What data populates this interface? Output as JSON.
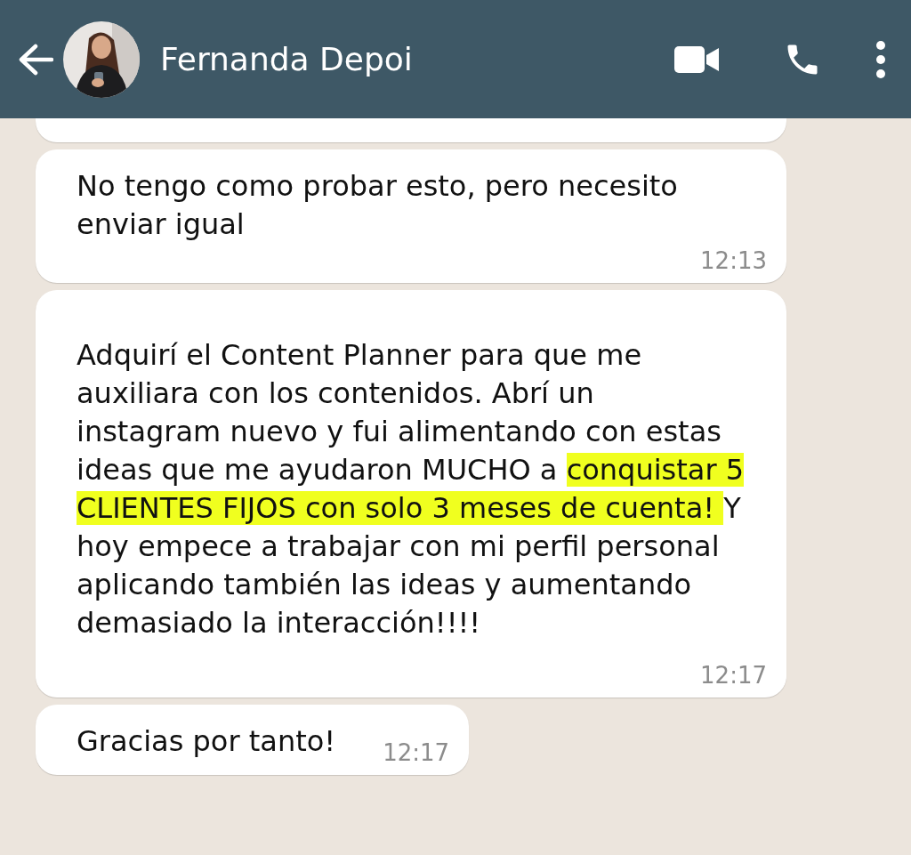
{
  "header": {
    "contact_name": "Fernanda Depoi"
  },
  "messages": [
    {
      "segments": [
        {
          "text": "No tengo como probar esto, pero necesito enviar igual",
          "highlighted": false
        }
      ],
      "time": "12:13"
    },
    {
      "segments": [
        {
          "text": "Adquirí el Content Planner para que me auxiliara con los contenidos. Abrí un instagram nuevo y fui alimentando con estas ideas que me ayudaron MUCHO a ",
          "highlighted": false
        },
        {
          "text": "conquistar 5 CLIENTES FIJOS con solo 3 meses de cuenta! ",
          "highlighted": true
        },
        {
          "text": "Y hoy empece a trabajar con mi perfil personal aplicando también las ideas y aumentando demasiado la interacción!!!!",
          "highlighted": false
        }
      ],
      "time": "12:17"
    },
    {
      "segments": [
        {
          "text": "Gracias por tanto!",
          "highlighted": false
        }
      ],
      "time": "12:17"
    }
  ]
}
